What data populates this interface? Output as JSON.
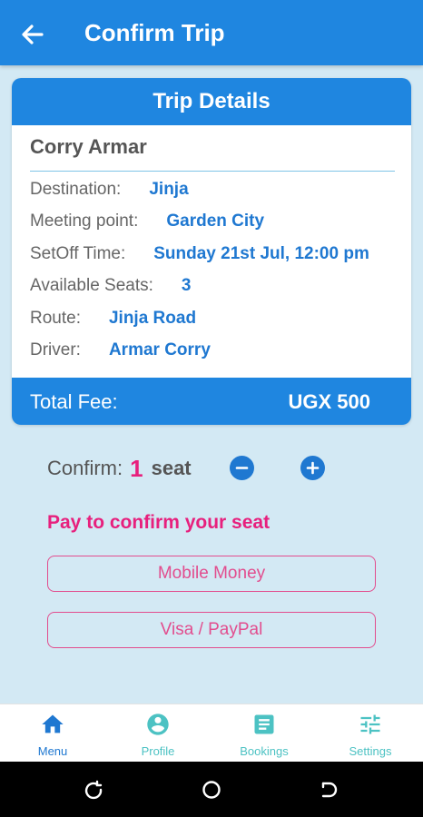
{
  "appbar": {
    "title": "Confirm Trip",
    "back_icon": "arrow-left-icon"
  },
  "trip_card": {
    "header": "Trip Details",
    "passenger": "Corry Armar",
    "rows": [
      {
        "label": "Destination:",
        "value": "Jinja"
      },
      {
        "label": "Meeting point:",
        "value": "Garden City"
      },
      {
        "label": "SetOff Time:",
        "value": "Sunday 21st Jul, 12:00 pm"
      },
      {
        "label": "Available Seats:",
        "value": "3"
      },
      {
        "label": "Route:",
        "value": "Jinja Road"
      },
      {
        "label": "Driver:",
        "value": "Armar Corry"
      }
    ],
    "total_label": "Total Fee:",
    "total_value": "UGX 500"
  },
  "confirm": {
    "label": "Confirm:",
    "count": "1",
    "unit": "seat"
  },
  "payment": {
    "title": "Pay to confirm your seat",
    "options": [
      "Mobile Money",
      "Visa / PayPal"
    ]
  },
  "bottom_nav": {
    "items": [
      {
        "label": "Menu",
        "icon": "home-icon",
        "active": true
      },
      {
        "label": "Profile",
        "icon": "account-circle-icon",
        "active": false
      },
      {
        "label": "Bookings",
        "icon": "book-icon",
        "active": false
      },
      {
        "label": "Settings",
        "icon": "sliders-icon",
        "active": false
      }
    ]
  },
  "colors": {
    "primary": "#1f86e0",
    "value_text": "#1f78d1",
    "accent_pink": "#e7207d",
    "background": "#d3e9f4",
    "nav_inactive": "#4cc2c3"
  }
}
